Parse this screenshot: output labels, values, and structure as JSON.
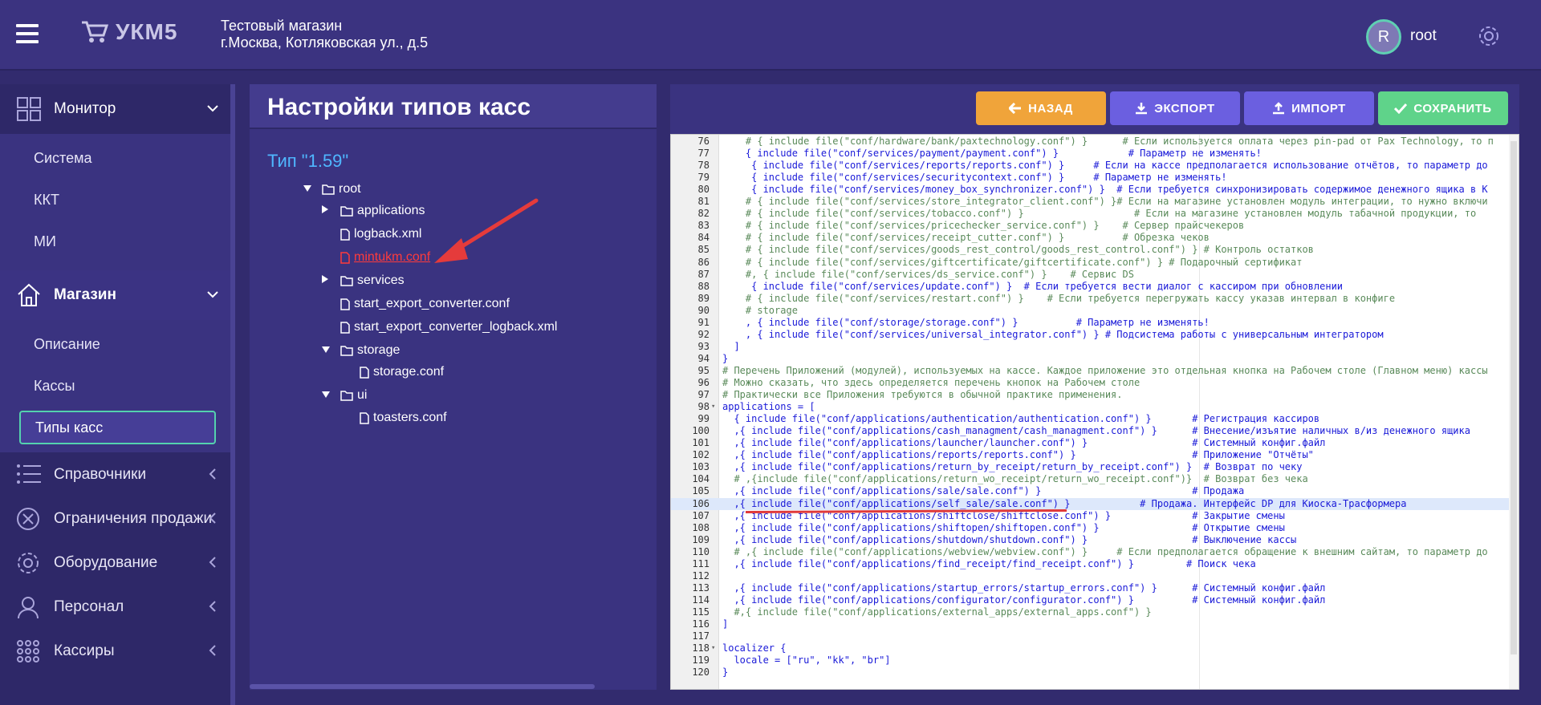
{
  "header": {
    "logo_text": "УКМ5",
    "store_name": "Тестовый магазин",
    "store_address": "г.Москва, Котляковская ул., д.5",
    "user_initial": "R",
    "user_name": "root"
  },
  "sidebar": {
    "monitor": "Монитор",
    "monitor_items": [
      "Система",
      "ККТ",
      "МИ"
    ],
    "store": "Магазин",
    "store_items": [
      "Описание",
      "Кассы",
      "Типы касс"
    ],
    "others": [
      "Справочники",
      "Ограничения продажи",
      "Оборудование",
      "Персонал",
      "Кассиры"
    ]
  },
  "left_panel": {
    "title": "Настройки типов касс",
    "type_label": "Тип \"1.59\"",
    "tree": [
      "root",
      "applications",
      "logback.xml",
      "mintukm.conf",
      "services",
      "start_export_converter.conf",
      "start_export_converter_logback.xml",
      "storage",
      "storage.conf",
      "ui",
      "toasters.conf"
    ]
  },
  "toolbar": {
    "back": "НАЗАД",
    "export": "ЭКСПОРТ",
    "import": "ИМПОРТ",
    "save": "СОХРАНИТЬ"
  },
  "editor": {
    "highlighted_line": 106,
    "lines": [
      {
        "n": "76",
        "t": "    # { include file(\"conf/hardware/bank/paxtechnology.conf\") }      # Если используется оплата через pin-pad от Pax Technology, то п",
        "c": true
      },
      {
        "n": "77",
        "t": "    { include file(\"conf/services/payment/payment.conf\") }            # Параметр не изменять!",
        "c": false
      },
      {
        "n": "78",
        "t": "     { include file(\"conf/services/reports/reports.conf\") }     # Если на кассе предполагается использование отчётов, то параметр до",
        "c": false
      },
      {
        "n": "79",
        "t": "     { include file(\"conf/services/securitycontext.conf\") }     # Параметр не изменять!",
        "c": false
      },
      {
        "n": "80",
        "t": "     { include file(\"conf/services/money_box_synchronizer.conf\") }  # Если требуется синхронизировать содержимое денежного ящика в К",
        "c": false
      },
      {
        "n": "81",
        "t": "    # { include file(\"conf/services/store_integrator_client.conf\") }# Если на магазине установлен модуль интеграции, то нужно включи",
        "c": true
      },
      {
        "n": "82",
        "t": "    # { include file(\"conf/services/tobacco.conf\") }                   # Если на магазине установлен модуль табачной продукции, то",
        "c": true
      },
      {
        "n": "83",
        "t": "    # { include file(\"conf/services/pricechecker_service.conf\") }    # Сервер прайсчекеров",
        "c": true
      },
      {
        "n": "84",
        "t": "    # { include file(\"conf/services/receipt_cutter.conf\") }          # Обрезка чеков",
        "c": true
      },
      {
        "n": "85",
        "t": "    # { include file(\"conf/services/goods_rest_control/goods_rest_control.conf\") } # Контроль остатков",
        "c": true
      },
      {
        "n": "86",
        "t": "    # { include file(\"conf/services/giftcertificate/giftcertificate.conf\") } # Подарочный сертификат",
        "c": true
      },
      {
        "n": "87",
        "t": "    #, { include file(\"conf/services/ds_service.conf\") }    # Сервис DS",
        "c": true
      },
      {
        "n": "88",
        "t": "     { include file(\"conf/services/update.conf\") }  # Если требуется вести диалог с кассиром при обновлении",
        "c": false
      },
      {
        "n": "89",
        "t": "    # { include file(\"conf/services/restart.conf\") }    # Если требуется перегружать кассу указав интервал в конфиге",
        "c": true
      },
      {
        "n": "90",
        "t": "    # storage",
        "c": true
      },
      {
        "n": "91",
        "t": "    , { include file(\"conf/storage/storage.conf\") }          # Параметр не изменять!",
        "c": false
      },
      {
        "n": "92",
        "t": "    , { include file(\"conf/services/universal_integrator.conf\") } # Подсистема работы с универсальным интегратором",
        "c": false
      },
      {
        "n": "93",
        "t": "  ]",
        "c": false
      },
      {
        "n": "94",
        "t": "}",
        "c": false
      },
      {
        "n": "95",
        "t": "# Перечень Приложений (модулей), используемых на кассе. Каждое приложение это отдельная кнопка на Рабочем столе (Главном меню) кассы",
        "c": true
      },
      {
        "n": "96",
        "t": "# Можно сказать, что здесь определяется перечень кнопок на Рабочем столе",
        "c": true
      },
      {
        "n": "97",
        "t": "# Практически все Приложения требуются в обычной практике применения.",
        "c": true
      },
      {
        "n": "98",
        "t": "applications = [",
        "c": false,
        "fold": true
      },
      {
        "n": "99",
        "t": "  { include file(\"conf/applications/authentication/authentication.conf\") }       # Регистрация кассиров",
        "c": false
      },
      {
        "n": "100",
        "t": "  ,{ include file(\"conf/applications/cash_managment/cash_managment.conf\") }      # Внесение/изъятие наличных в/из денежного ящика",
        "c": false
      },
      {
        "n": "101",
        "t": "  ,{ include file(\"conf/applications/launcher/launcher.conf\") }                  # Системный конфиг.файл",
        "c": false
      },
      {
        "n": "102",
        "t": "  ,{ include file(\"conf/applications/reports/reports.conf\") }                    # Приложение \"Отчёты\"",
        "c": false
      },
      {
        "n": "103",
        "t": "  ,{ include file(\"conf/applications/return_by_receipt/return_by_receipt.conf\") }  # Возврат по чеку",
        "c": false
      },
      {
        "n": "104",
        "t": "  # ,{include file(\"conf/applications/return_wo_receipt/return_wo_receipt.conf\")}  # Возврат без чека",
        "c": true
      },
      {
        "n": "105",
        "t": "  ,{ include file(\"conf/applications/sale/sale.conf\") }                          # Продажа",
        "c": false
      },
      {
        "n": "106",
        "t": "  ,{ include file(\"conf/applications/self_sale/sale.conf\") }            # Продажа. Интерфейс DP для Киоска-Трасформера",
        "c": false
      },
      {
        "n": "107",
        "t": "  ,{ include file(\"conf/applications/shiftclose/shiftclose.conf\") }              # Закрытие смены",
        "c": false
      },
      {
        "n": "108",
        "t": "  ,{ include file(\"conf/applications/shiftopen/shiftopen.conf\") }                # Открытие смены",
        "c": false
      },
      {
        "n": "109",
        "t": "  ,{ include file(\"conf/applications/shutdown/shutdown.conf\") }                  # Выключение кассы",
        "c": false
      },
      {
        "n": "110",
        "t": "  # ,{ include file(\"conf/applications/webview/webview.conf\") }     # Если предполагается обращение к внешним сайтам, то параметр до",
        "c": true
      },
      {
        "n": "111",
        "t": "  ,{ include file(\"conf/applications/find_receipt/find_receipt.conf\") }         # Поиск чека",
        "c": false
      },
      {
        "n": "112",
        "t": "",
        "c": false
      },
      {
        "n": "113",
        "t": "  ,{ include file(\"conf/applications/startup_errors/startup_errors.conf\") }      # Системный конфиг.файл",
        "c": false
      },
      {
        "n": "114",
        "t": "  ,{ include file(\"conf/applications/configurator/configurator.conf\") }          # Системный конфиг.файл",
        "c": false
      },
      {
        "n": "115",
        "t": "  #,{ include file(\"conf/applications/external_apps/external_apps.conf\") }",
        "c": true
      },
      {
        "n": "116",
        "t": "]",
        "c": false
      },
      {
        "n": "117",
        "t": "",
        "c": false
      },
      {
        "n": "118",
        "t": "localizer {",
        "c": false,
        "fold": true
      },
      {
        "n": "119",
        "t": "  locale = [\"ru\", \"kk\", \"br\"]",
        "c": false
      },
      {
        "n": "120",
        "t": "}",
        "c": false
      }
    ]
  }
}
